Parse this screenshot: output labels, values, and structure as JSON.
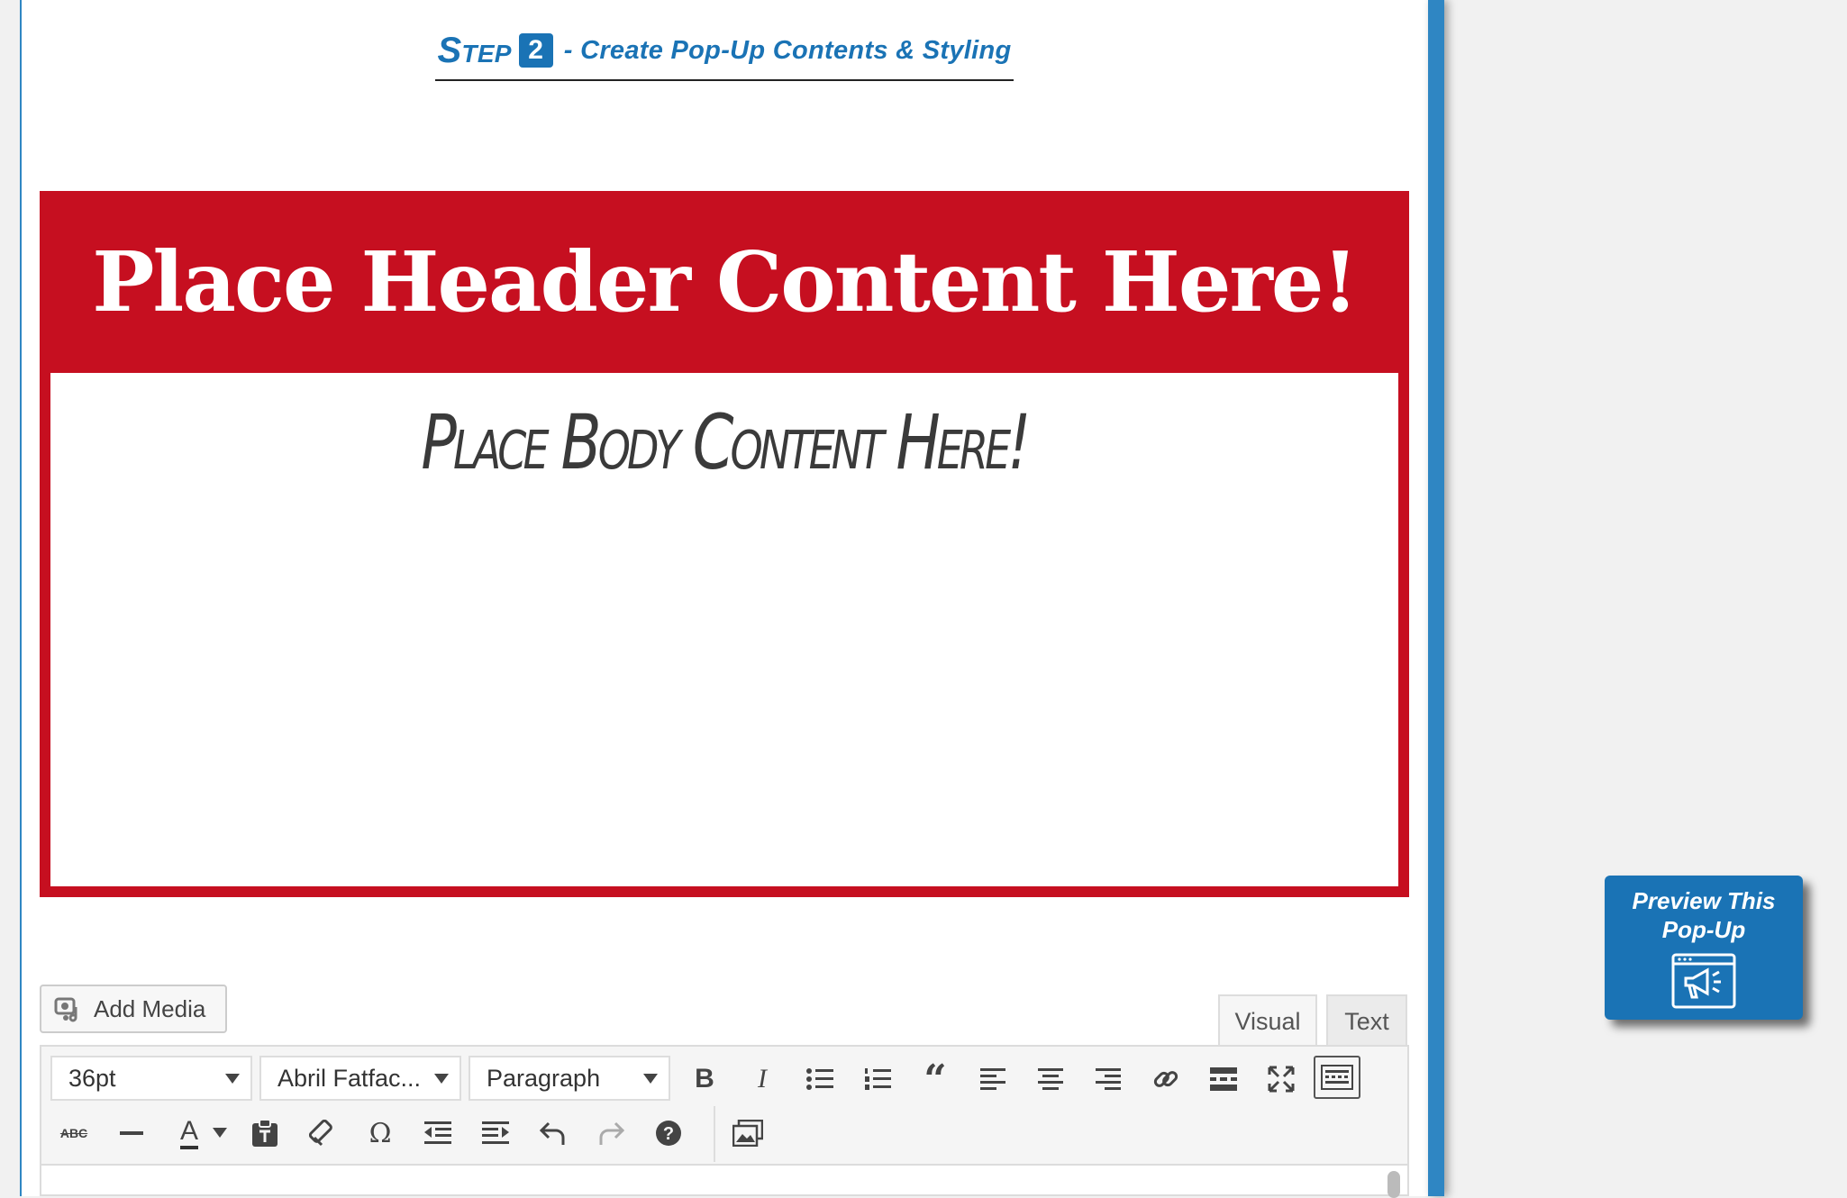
{
  "step": {
    "word": "Step",
    "number": "2",
    "title": "- Create Pop-Up Contents & Styling"
  },
  "popup": {
    "header_text": "Place Header Content Here!",
    "body_text": "Place Body Content Here!",
    "colors": {
      "frame": "#c60f20",
      "body_text": "#3a3a3a"
    }
  },
  "editor": {
    "add_media_label": "Add Media",
    "tabs": {
      "visual": "Visual",
      "text": "Text"
    },
    "font_size": "36pt",
    "font_family": "Abril Fatfac...",
    "format": "Paragraph",
    "toolbar_row1_icons": [
      "bold-icon",
      "italic-icon",
      "bulleted-list-icon",
      "numbered-list-icon",
      "blockquote-icon",
      "align-left-icon",
      "align-center-icon",
      "align-right-icon",
      "link-icon",
      "read-more-icon",
      "fullscreen-icon",
      "toolbar-toggle-icon"
    ],
    "toolbar_row2_icons": [
      "strikethrough-icon",
      "horizontal-line-icon",
      "text-color-icon",
      "paste-as-text-icon",
      "clear-formatting-icon",
      "special-character-icon",
      "outdent-icon",
      "indent-icon",
      "undo-icon",
      "redo-icon",
      "help-icon",
      "gallery-icon"
    ]
  },
  "preview": {
    "label": "Preview This\nPop-Up",
    "icon": "megaphone-window-icon"
  },
  "colors": {
    "accent": "#1a73b5",
    "rail": "#2f86c3"
  }
}
